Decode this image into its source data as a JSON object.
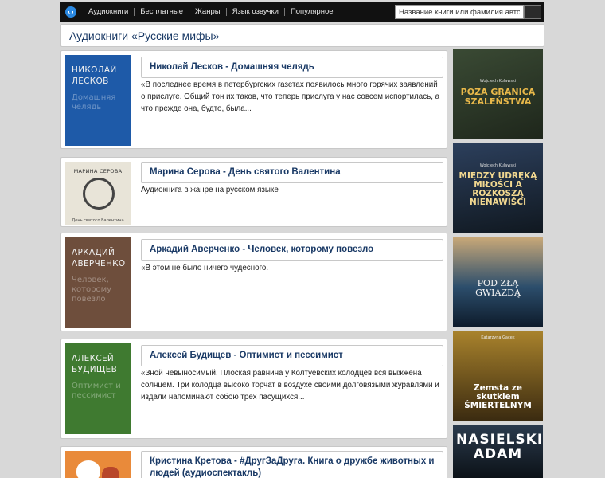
{
  "nav": {
    "items": [
      "Аудиокниги",
      "Бесплатные",
      "Жанры",
      "Язык озвучки",
      "Популярное"
    ],
    "search_placeholder": "Название книги или фамилия автора"
  },
  "page_title": "Аудиокниги «Русские мифы»",
  "books": [
    {
      "title": "Николай Лесков - Домашняя челядь",
      "desc": "«В последнее время в петербургских газетах появилось много горячих заявлений о прислуге. Общий тон их таков, что теперь прислуга у нас совсем испортилась, а что прежде она, будто, была...",
      "cover_author": "НИКОЛАЙ ЛЕСКОВ",
      "cover_sub": "Домашняя челядь",
      "cover_color": "#1e5aa8"
    },
    {
      "title": "Марина Серова - День святого Валентина",
      "desc": "Аудиокнига в жанре на русском языке",
      "cover_author": "МАРИНА СЕРОВА",
      "cover_sub": "День святого Валентина",
      "cover_color": "#e8e4d8"
    },
    {
      "title": "Аркадий Аверченко - Человек, которому повезло",
      "desc": "«В этом не было ничего чудесного.",
      "cover_author": "АРКАДИЙ АВЕРЧЕНКО",
      "cover_sub": "Человек, которому повезло",
      "cover_color": "#6e4e3c"
    },
    {
      "title": "Алексей Будищев - Оптимист и пессимист",
      "desc": "«Зной невыносимый. Плоская равнина у Колтуевских колодцев вся выжжена солнцем. Три колодца высоко торчат в воздухе своими долговязыми журавлями и издали напоминают собою трех пасущихся...",
      "cover_author": "АЛЕКСЕЙ БУДИЩЕВ",
      "cover_sub": "Оптимист и пессимист",
      "cover_color": "#3f7a30"
    },
    {
      "title": "Кристина Кретова - #ДругЗаДруга. Книга о дружбе животных и людей (аудиоспектакль)",
      "desc": "",
      "cover_author": "",
      "cover_sub": "",
      "cover_color": "#e98a3a"
    }
  ],
  "sidebar": [
    {
      "title": "POZA GRANICĄ SZALEŃSTWA",
      "author": "Wojciech Kulawski",
      "color": "#2e3b2a"
    },
    {
      "title": "MIĘDZY UDRĘKĄ MIŁOŚCI A ROZKOSZĄ NIENAWIŚCI",
      "author": "Wojciech Kulawski",
      "color": "#1f2f44"
    },
    {
      "title": "POD ZŁĄ GWIAZDĄ",
      "author": "",
      "color": "#2c4e6c"
    },
    {
      "title": "Zemsta ze skutkiem ŚMIERTELNYM",
      "author": "Katarzyna Gacek",
      "color": "#5a4420"
    },
    {
      "title": "NASIELSKI ADAM",
      "author": "",
      "color": "#1d2a3a"
    }
  ]
}
